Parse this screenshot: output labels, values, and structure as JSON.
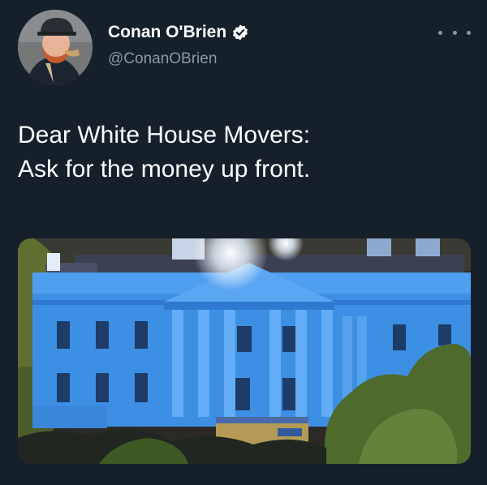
{
  "tweet": {
    "author_name": "Conan O'Brien",
    "author_handle": "@ConanOBrien",
    "text_line1": "Dear White House Movers:",
    "text_line2": "Ask for the money up front."
  },
  "icons": {
    "verified": "verified-badge-icon",
    "more": "more-options-icon"
  },
  "colors": {
    "background": "#15202b",
    "handle": "#8b98a5",
    "building": "#3d8fe4"
  }
}
